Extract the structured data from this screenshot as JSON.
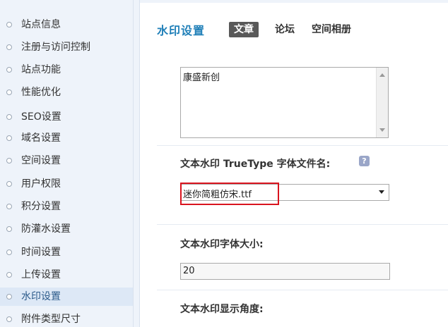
{
  "sidebar": {
    "items": [
      {
        "label": "站点信息"
      },
      {
        "label": "注册与访问控制"
      },
      {
        "label": "站点功能"
      },
      {
        "label": "性能优化"
      },
      {
        "label": "SEO设置"
      },
      {
        "label": "域名设置"
      },
      {
        "label": "空间设置"
      },
      {
        "label": "用户权限"
      },
      {
        "label": "积分设置"
      },
      {
        "label": "防灌水设置"
      },
      {
        "label": "时间设置"
      },
      {
        "label": "上传设置"
      },
      {
        "label": "水印设置"
      },
      {
        "label": "附件类型尺寸"
      }
    ],
    "active_index": 12
  },
  "header": {
    "title": "水印设置",
    "tabs": [
      {
        "label": "文章"
      },
      {
        "label": "论坛"
      },
      {
        "label": "空间相册"
      }
    ],
    "active_tab": 0
  },
  "form": {
    "watermark_text_value": "康盛新创",
    "font_label": "文本水印 TrueType 字体文件名:",
    "font_help_icon": "question-icon",
    "font_selected": "迷你简粗仿宋.ttf",
    "size_label": "文本水印字体大小:",
    "size_value": "20",
    "angle_label": "文本水印显示角度:"
  },
  "colors": {
    "accent": "#1f7fb8",
    "active_tab_bg": "#595959",
    "highlight": "#d9141e"
  }
}
